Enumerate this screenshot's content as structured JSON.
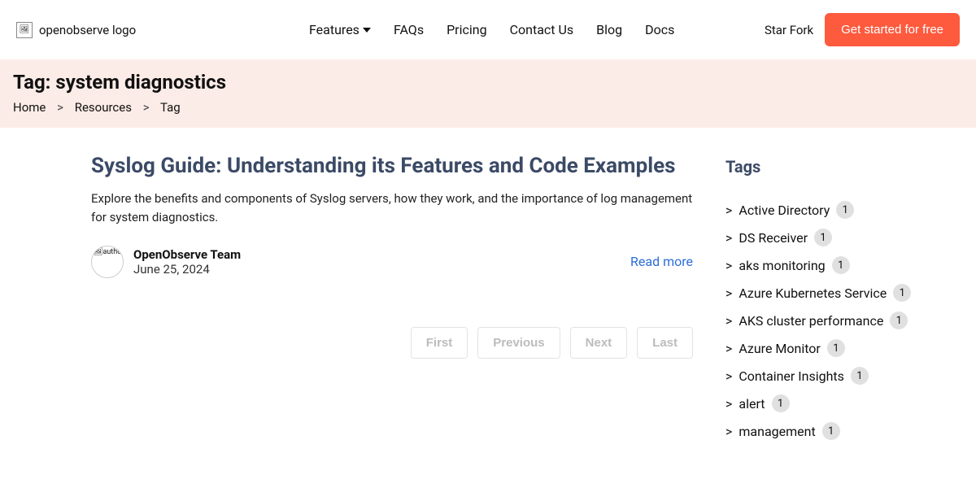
{
  "logo_alt": "openobserve logo",
  "nav": [
    "Features",
    "FAQs",
    "Pricing",
    "Contact Us",
    "Blog",
    "Docs"
  ],
  "star_fork": "Star Fork",
  "cta": "Get started for free",
  "banner_title": "Tag: system diagnostics",
  "breadcrumb": [
    "Home",
    "Resources",
    "Tag"
  ],
  "post": {
    "title": "Syslog Guide: Understanding its Features and Code Examples",
    "excerpt": "Explore the benefits and components of Syslog servers, how they work, and the importance of log management for system diagnostics.",
    "author": "OpenObserve Team",
    "date": "June 25, 2024",
    "read_more": "Read more",
    "avatar_alt": "authc"
  },
  "pagination": [
    "First",
    "Previous",
    "Next",
    "Last"
  ],
  "tags_heading": "Tags",
  "tags": [
    {
      "label": "Active Directory",
      "count": "1"
    },
    {
      "label": "DS Receiver",
      "count": "1"
    },
    {
      "label": "aks monitoring",
      "count": "1"
    },
    {
      "label": "Azure Kubernetes Service",
      "count": "1"
    },
    {
      "label": "AKS cluster performance",
      "count": "1"
    },
    {
      "label": "Azure Monitor",
      "count": "1"
    },
    {
      "label": "Container Insights",
      "count": "1"
    },
    {
      "label": "alert",
      "count": "1"
    },
    {
      "label": "management",
      "count": "1"
    }
  ]
}
